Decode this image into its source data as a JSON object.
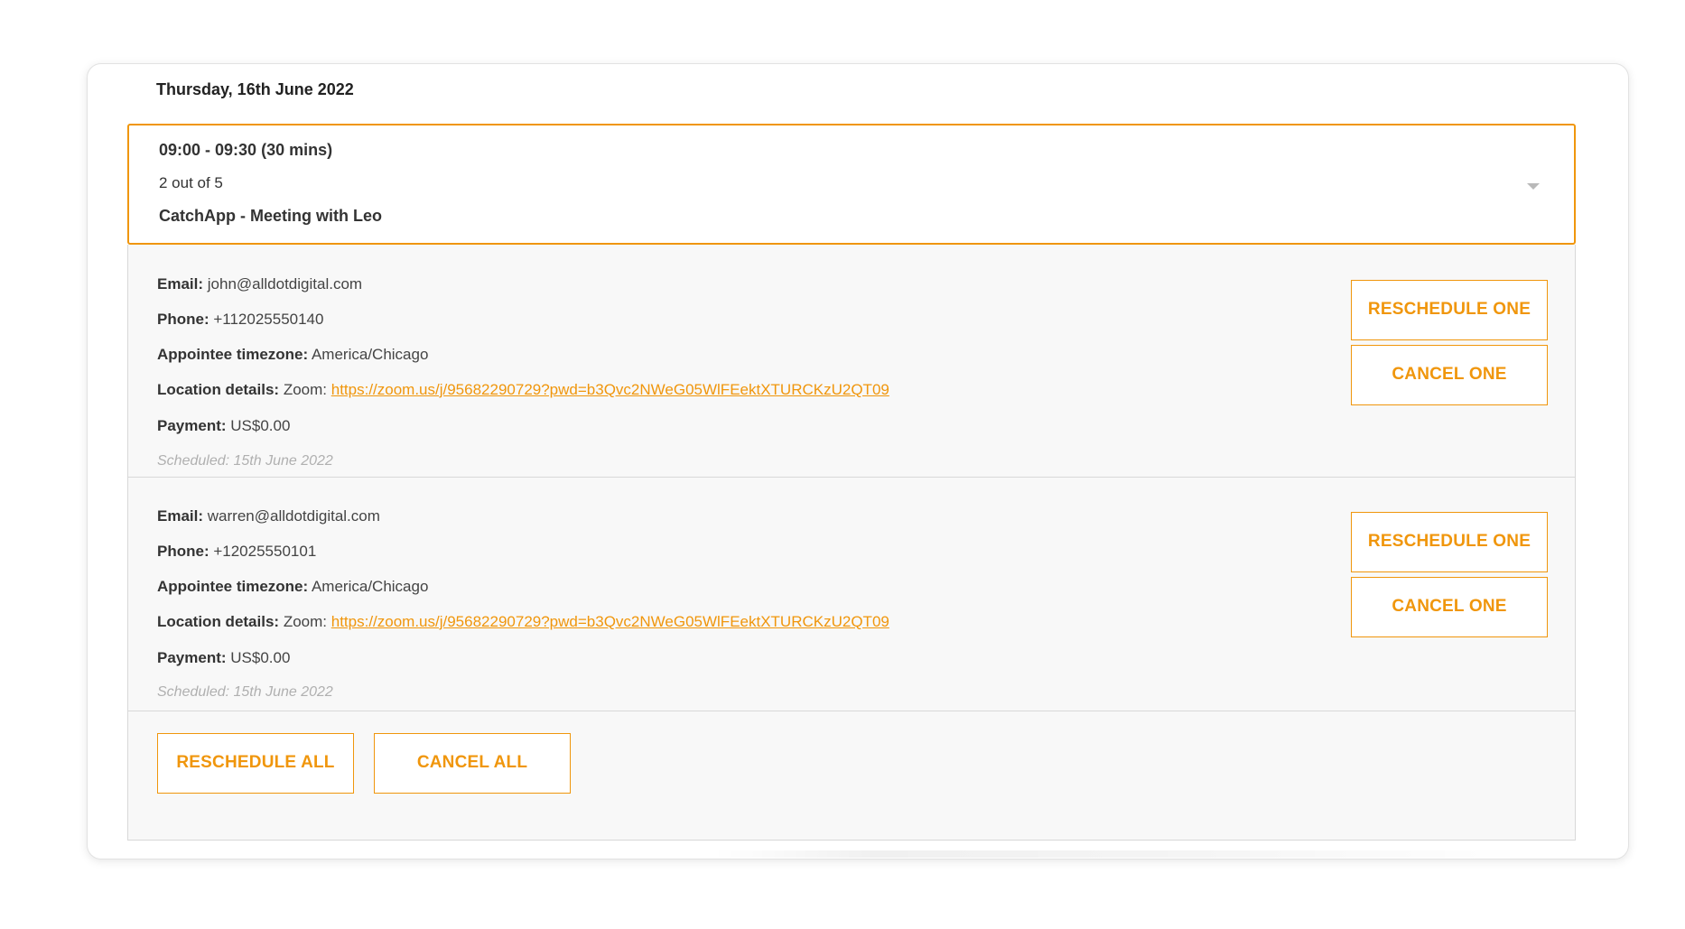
{
  "booking": {
    "date": "Thursday, 16th June 2022",
    "time_range": "09:00 - 09:30 (30 mins)",
    "count": "2 out of 5",
    "title": "CatchApp - Meeting with Leo"
  },
  "labels": {
    "email": "Email:",
    "phone": "Phone:",
    "timezone": "Appointee timezone:",
    "location": "Location details:",
    "payment": "Payment:"
  },
  "attendees": [
    {
      "email": "john@alldotdigital.com",
      "phone": "+112025550140",
      "timezone": "America/Chicago",
      "location_prefix": "Zoom:",
      "location_link": "https://zoom.us/j/95682290729?pwd=b3Qvc2NWeG05WlFEektXTURCKzU2QT09",
      "payment": "US$0.00",
      "scheduled": "Scheduled: 15th June 2022",
      "reschedule_label": "RESCHEDULE ONE",
      "cancel_label": "CANCEL ONE"
    },
    {
      "email": "warren@alldotdigital.com",
      "phone": "+12025550101",
      "timezone": "America/Chicago",
      "location_prefix": "Zoom:",
      "location_link": "https://zoom.us/j/95682290729?pwd=b3Qvc2NWeG05WlFEektXTURCKzU2QT09",
      "payment": "US$0.00",
      "scheduled": "Scheduled: 15th June 2022",
      "reschedule_label": "RESCHEDULE ONE",
      "cancel_label": "CANCEL ONE"
    }
  ],
  "footer": {
    "reschedule_all_label": "RESCHEDULE ALL",
    "cancel_all_label": "CANCEL ALL"
  },
  "colors": {
    "accent": "#f0960c",
    "panel_bg": "#f8f8f8"
  },
  "icons": {
    "expand": "chevron-down-icon"
  }
}
